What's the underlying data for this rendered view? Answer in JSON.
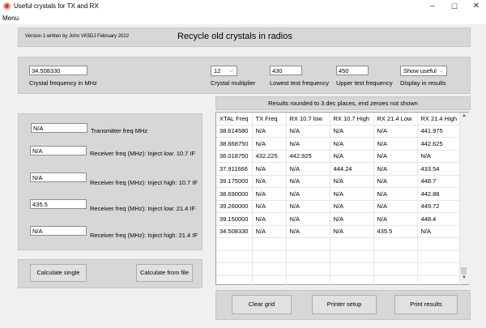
{
  "window": {
    "title": "Useful crystals for TX and RX",
    "minimize": "–",
    "maximize": "☐",
    "close": "✕"
  },
  "menu": {
    "label": "Menu"
  },
  "header": {
    "credit": "Version 1 written by  John VK5DJ February 2022",
    "title": "Recycle old crystals in radios"
  },
  "inputs": {
    "crystal_freq": {
      "value": "34.508330",
      "label": "Crystal frequency in MHz"
    },
    "multiplier": {
      "value": "12",
      "label": "Crystal multiplier"
    },
    "lowest_test": {
      "value": "430",
      "label": "Lowest test frequency"
    },
    "upper_test": {
      "value": "450",
      "label": "Upper test frequency"
    },
    "display": {
      "value": "Show useful",
      "label": "Display  in results"
    }
  },
  "outputs": {
    "tx": {
      "value": "N/A",
      "label": "Transmitter freq MHz"
    },
    "rx_low_10_7": {
      "value": "N/A",
      "label": "Receiver freq (MHz): Inject low: 10.7 IF"
    },
    "rx_high_10_7": {
      "value": "N/A",
      "label": "Receiver freq (MHz): Inject high: 10.7 IF"
    },
    "rx_low_21_4": {
      "value": "435.5",
      "label": "Receiver freq (MHz): Inject low: 21.4 IF"
    },
    "rx_high_21_4": {
      "value": "N/A",
      "label": "Receiver freq (MHz): Inject high: 21.4 IF"
    }
  },
  "buttons": {
    "calc_single": "Calculate single",
    "calc_file": "Calculate from file",
    "clear_grid": "Clear grid",
    "printer_setup": "Printer setup",
    "print_results": "Print results"
  },
  "results": {
    "header": "Results rounded to 3 dec places, end zeroes not shown",
    "columns": [
      "XTAL Freq",
      "TX Freq",
      "RX 10.7 low",
      "RX 10.7 High",
      "RX 21.4 Low",
      "RX 21.4 High"
    ],
    "rows": [
      [
        "38.614580",
        "N/A",
        "N/A",
        "N/A",
        "N/A",
        "441.975"
      ],
      [
        "38.668750",
        "N/A",
        "N/A",
        "N/A",
        "N/A",
        "442.625"
      ],
      [
        "36.018750",
        "432.225",
        "442.925",
        "N/A",
        "N/A",
        "N/A"
      ],
      [
        "37.911666",
        "N/A",
        "N/A",
        "444.24",
        "N/A",
        "433.54"
      ],
      [
        "39.175000",
        "N/A",
        "N/A",
        "N/A",
        "N/A",
        "448.7"
      ],
      [
        "38.690000",
        "N/A",
        "N/A",
        "N/A",
        "N/A",
        "442.88"
      ],
      [
        "39.260000",
        "N/A",
        "N/A",
        "N/A",
        "N/A",
        "449.72"
      ],
      [
        "39.150000",
        "N/A",
        "N/A",
        "N/A",
        "N/A",
        "448.4"
      ],
      [
        "34.508330",
        "N/A",
        "N/A",
        "N/A",
        "435.5",
        "N/A"
      ],
      [
        "",
        "",
        "",
        "",
        "",
        ""
      ],
      [
        "",
        "",
        "",
        "",
        "",
        ""
      ],
      [
        "",
        "",
        "",
        "",
        "",
        ""
      ],
      [
        "",
        "",
        "",
        "",
        "",
        ""
      ],
      [
        "",
        "",
        "",
        "",
        "",
        ""
      ]
    ]
  }
}
